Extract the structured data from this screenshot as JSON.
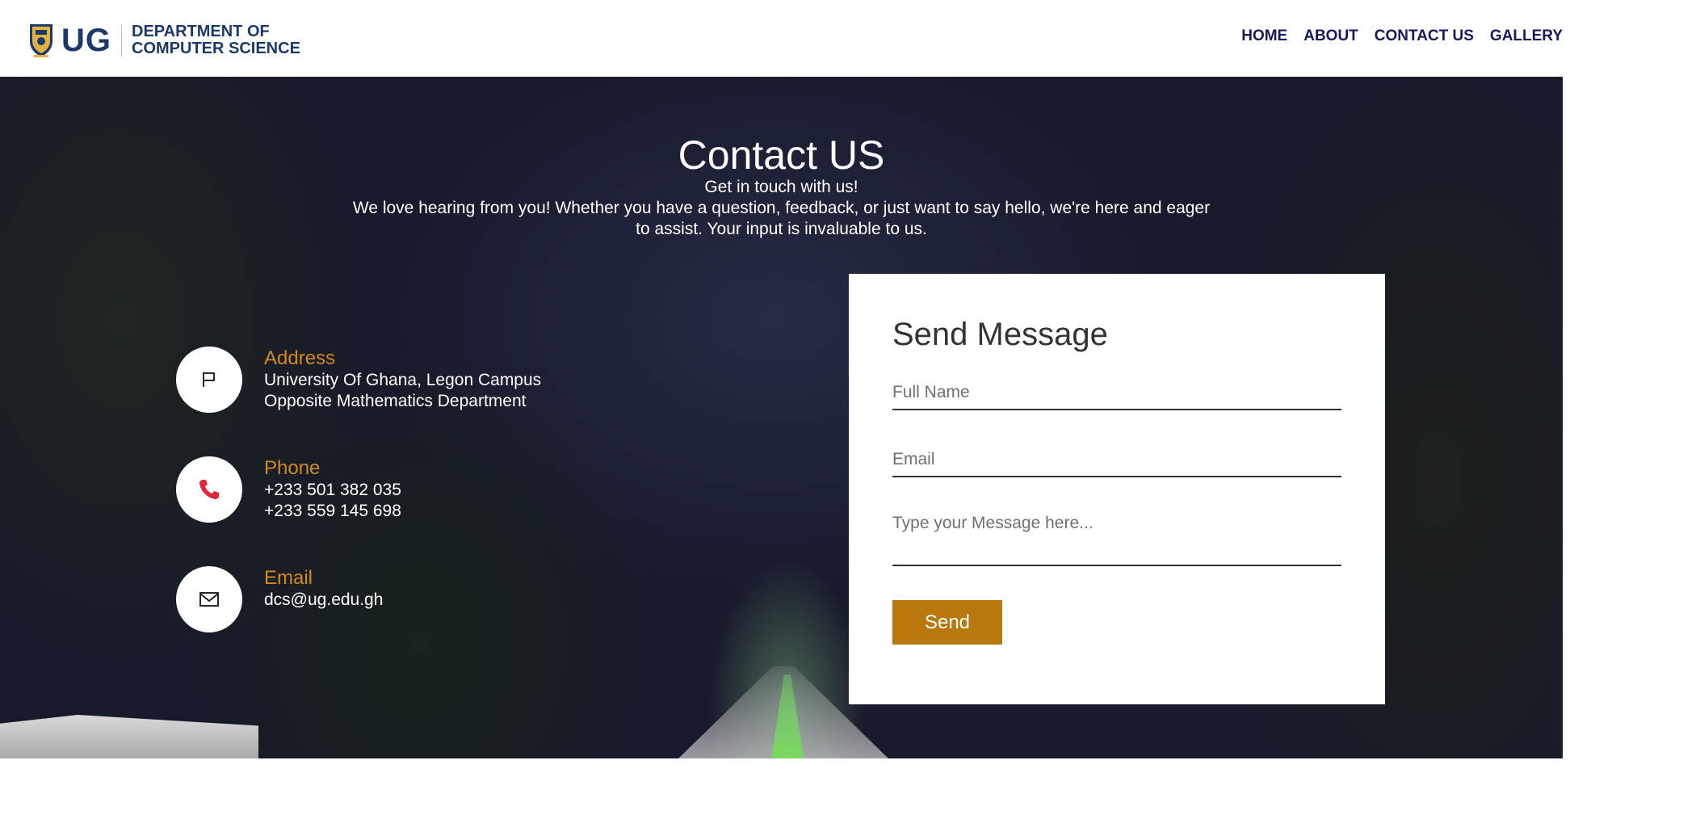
{
  "header": {
    "logo_mark": "UG",
    "logo_line1": "DEPARTMENT OF",
    "logo_line2": "COMPUTER SCIENCE",
    "nav": [
      "HOME",
      "ABOUT",
      "CONTACT US",
      "GALLERY"
    ]
  },
  "hero": {
    "title": "Contact US",
    "subtitle": "Get in touch with us!",
    "intro": "We love hearing from you! Whether you have a question, feedback, or just want to say hello, we're here and eager to assist. Your input is invaluable to us."
  },
  "contact": {
    "address": {
      "icon": "flag-icon",
      "label": "Address",
      "lines": [
        "University Of Ghana, Legon Campus",
        "Opposite Mathematics Department"
      ]
    },
    "phone": {
      "icon": "phone-icon",
      "label": "Phone",
      "lines": [
        "+233 501 382 035",
        "+233 559 145 698"
      ]
    },
    "email": {
      "icon": "mail-icon",
      "label": "Email",
      "lines": [
        "dcs@ug.edu.gh"
      ]
    }
  },
  "form": {
    "title": "Send Message",
    "name_placeholder": "Full Name",
    "email_placeholder": "Email",
    "message_placeholder": "Type your Message here...",
    "send_label": "Send"
  },
  "colors": {
    "brand_navy": "#1b3a6b",
    "accent_gold": "#b8780c",
    "label_orange": "#d4891f"
  }
}
